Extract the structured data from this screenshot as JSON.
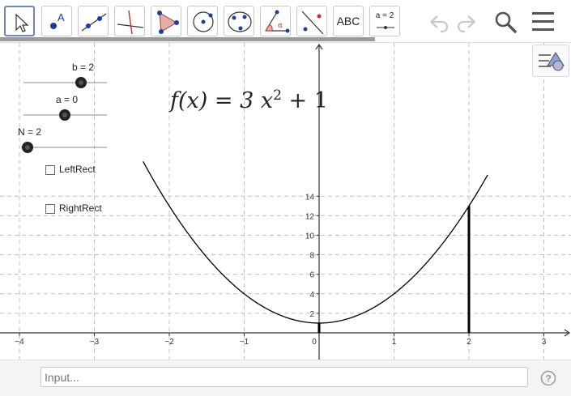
{
  "toolbar": {
    "tools": [
      {
        "name": "move-tool",
        "icon": "cursor-arrow"
      },
      {
        "name": "point-tool",
        "icon": "point-with-label"
      },
      {
        "name": "line-tool",
        "icon": "line-through-two-points"
      },
      {
        "name": "perpendicular-line-tool",
        "icon": "perpendicular-line"
      },
      {
        "name": "polygon-tool",
        "icon": "triangle-polygon"
      },
      {
        "name": "circle-tool",
        "icon": "circle-center-point"
      },
      {
        "name": "conic-tool",
        "icon": "ellipse-through-points"
      },
      {
        "name": "angle-tool",
        "icon": "angle-alpha"
      },
      {
        "name": "reflect-tool",
        "icon": "reflect-about-line"
      },
      {
        "name": "text-tool",
        "label": "ABC"
      },
      {
        "name": "slider-tool",
        "label": "a = 2"
      }
    ],
    "selected_tool": "move-tool",
    "right": [
      "undo-icon",
      "redo-icon",
      "search-icon",
      "menu-icon"
    ]
  },
  "sliders": [
    {
      "label": "b = 2",
      "value": 2
    },
    {
      "label": "a = 0",
      "value": 0
    },
    {
      "label": "N = 2",
      "value": 2
    }
  ],
  "checkboxes": [
    {
      "label": "LeftRect",
      "checked": false
    },
    {
      "label": "RightRect",
      "checked": false
    }
  ],
  "formula": {
    "prefix": "f(x) = 3 x",
    "exponent": "2",
    "suffix": " + 1"
  },
  "graph": {
    "x_ticks": [
      "−4",
      "−3",
      "−2",
      "−1",
      "0",
      "1",
      "2",
      "3"
    ],
    "y_ticks": [
      "2",
      "4",
      "6",
      "8",
      "10",
      "12",
      "14"
    ],
    "function": {
      "a_coef": 3,
      "power": 2,
      "const": 1
    },
    "interval": {
      "a": 0,
      "b": 2
    },
    "grid": true,
    "colors": {
      "axis": "#333333",
      "grid": "#c0c0c0",
      "curve": "#000000"
    }
  },
  "input_bar": {
    "placeholder": "Input..."
  },
  "help": {
    "icon": "help-icon",
    "label": "?"
  },
  "colors": {
    "selected_border": "#6e86b8",
    "icon_blue": "#1a3f9c",
    "polygon_fill": "#e0b0a8"
  }
}
